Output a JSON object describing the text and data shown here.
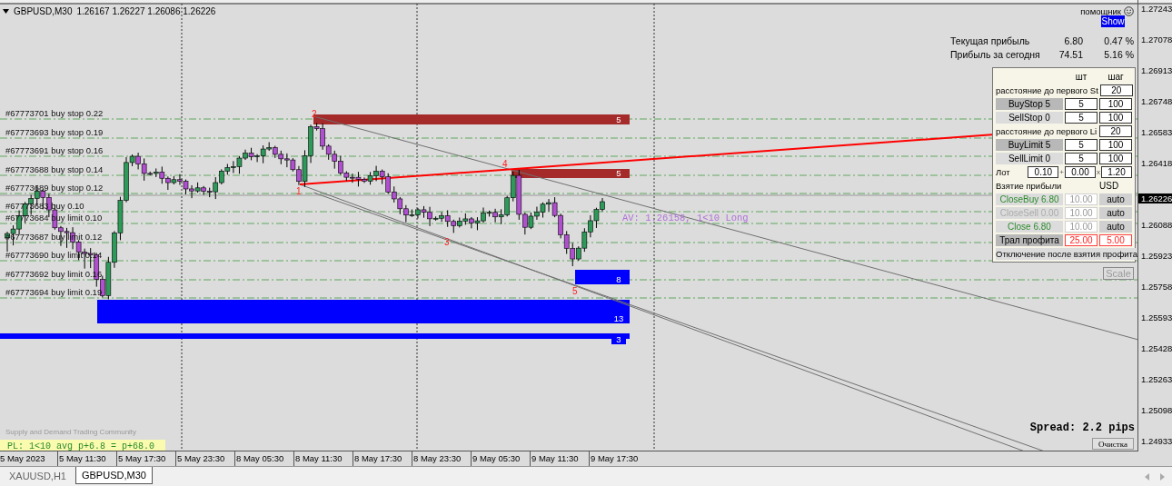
{
  "chart": {
    "symbol": "GBPUSD,M30",
    "quote": "1.26167 1.26227 1.26086 1.26226",
    "order_labels": [
      "#67773701 buy stop 0.22",
      "#67773693 buy stop 0.19",
      "#67773691 buy stop 0.16",
      "#67773688 buy stop 0.14",
      "#67773689 buy stop 0.12",
      "#67773683 buy 0.10",
      "#67773684 buy limit 0.10",
      "#67773687 buy limit 0.12",
      "#67773690 buy limit 0.14",
      "#67773692 buy limit 0.16",
      "#67773694 buy limit 0.19"
    ],
    "zones": [
      {
        "kind": "sell",
        "count": "5"
      },
      {
        "kind": "sell",
        "count": "5"
      },
      {
        "kind": "buy",
        "count": "8"
      },
      {
        "kind": "buy",
        "count": "13"
      },
      {
        "kind": "buy",
        "count": "3"
      }
    ],
    "wave_labels": [
      "1",
      "2",
      "3",
      "4",
      "5"
    ],
    "average": "AV: 1.26158, 1<10 Long",
    "community": "Supply and Demand Trading Community",
    "pl": "PL: 1<10 avg p+6.8 = p+68.0",
    "spread": "Spread: 2.2 pips",
    "clear_button": "Очистка",
    "scale_button": "Scale"
  },
  "helper": {
    "label": "помощник",
    "show_button": "Show"
  },
  "profit": [
    {
      "label": "Текущая прибыль",
      "value": "6.80",
      "percent": "0.47 %"
    },
    {
      "label": "Прибыль за сегодня",
      "value": "74.51",
      "percent": "5.16 %"
    }
  ],
  "panel": {
    "headers": [
      "шт",
      "шаг"
    ],
    "rows": [
      {
        "kind": "distance",
        "label": "расстояние до первого St",
        "value": "20"
      },
      {
        "kind": "order",
        "button": "BuyStop 5",
        "pressed": true,
        "count": "5",
        "step": "100"
      },
      {
        "kind": "order",
        "button": "SellStop 0",
        "pressed": false,
        "count": "5",
        "step": "100"
      },
      {
        "kind": "distance",
        "label": "расстояние до первого Li",
        "value": "20"
      },
      {
        "kind": "order",
        "button": "BuyLimit 5",
        "pressed": true,
        "count": "5",
        "step": "100"
      },
      {
        "kind": "order",
        "button": "SellLimit 0",
        "pressed": false,
        "count": "5",
        "step": "100"
      },
      {
        "kind": "lot",
        "label": "Лот",
        "values": [
          "0.10",
          "0.00",
          "1.20"
        ],
        "operators": [
          "+",
          "x"
        ]
      },
      {
        "kind": "heading",
        "label": "Взятие прибыли",
        "currency": "USD"
      },
      {
        "kind": "close",
        "button": "CloseBuy 6.80",
        "disabled": false,
        "value": "10.00",
        "mode": "auto"
      },
      {
        "kind": "close",
        "button": "CloseSell 0.00",
        "disabled": true,
        "value": "10.00",
        "mode": "auto"
      },
      {
        "kind": "close",
        "button": "Close 6.80",
        "disabled": false,
        "value": "10.00",
        "mode": "auto"
      },
      {
        "kind": "trail",
        "button": "Трал профита",
        "pressed": true,
        "values": [
          "25.00",
          "5.00"
        ]
      },
      {
        "kind": "footer",
        "button": "Отключение после взятия профита"
      }
    ]
  },
  "price_axis": [
    "1.27243",
    "1.27078",
    "1.26913",
    "1.26748",
    "1.26583",
    "1.26418",
    "1.26088",
    "1.25923",
    "1.25758",
    "1.25593",
    "1.25428",
    "1.25263",
    "1.25098",
    "1.24933"
  ],
  "current_price": "1.26226",
  "time_axis": [
    "5 May 2023",
    "5 May 11:30",
    "5 May 17:30",
    "5 May 23:30",
    "8 May 05:30",
    "8 May 11:30",
    "8 May 17:30",
    "8 May 23:30",
    "9 May 05:30",
    "9 May 11:30",
    "9 May 17:30"
  ],
  "tabs": [
    {
      "label": "XAUUSD,H1",
      "selected": false
    },
    {
      "label": "GBPUSD,M30",
      "selected": true
    }
  ]
}
